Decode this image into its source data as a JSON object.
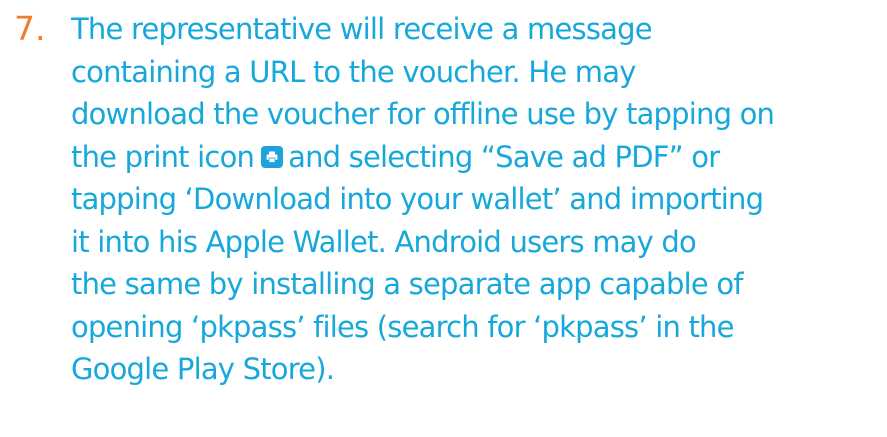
{
  "step": {
    "number": "7.",
    "lines": [
      {
        "text": "The representative will receive a message"
      },
      {
        "text": "containing a URL to the voucher. He may"
      },
      {
        "text": "download the voucher for offline use by tapping on"
      },
      {
        "before_icon": "the print icon",
        "icon": "print-icon",
        "after_icon": "and selecting “Save ad PDF” or"
      },
      {
        "text": "tapping ‘Download into your wallet’ and importing"
      },
      {
        "text": "it into his Apple Wallet. Android users may do"
      },
      {
        "text": "the same by installing a separate app capable of"
      },
      {
        "text": "opening ‘pkpass’ files (search for ‘pkpass’ in the"
      },
      {
        "text": "Google Play Store)."
      }
    ]
  },
  "colors": {
    "number": "#f07d2a",
    "text": "#17a8db",
    "icon_background": "#1fa3dc"
  }
}
